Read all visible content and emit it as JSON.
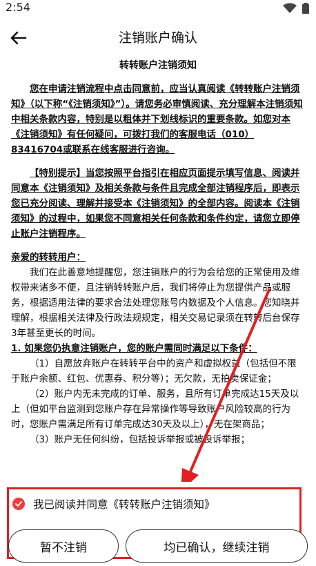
{
  "status_bar": {
    "time": "2:54"
  },
  "header": {
    "title": "注销账户确认"
  },
  "document": {
    "title": "转转账户注销须知",
    "intro": "您在申请注销流程中点击同意前，应当认真阅读《转转账户注销须知》（以下称“《注销须知》”）。请您务必审慎阅读、充分理解本注销须知中相关条款内容，特别是以粗体并下划线标识的重要条款。如您对本《注销须知》有任何疑问，可拨打我们的客服电话（010）83416704或联系在线客服进行咨询。",
    "notice": "【特别提示】当您按照平台指引在相应页面提示填写信息、阅读并同意本《注销须知》及相关条款与条件且完成全部注销程序后，即表示您已充分阅读、理解并接受本《注销须知》的全部内容。阅读本《注销须知》的过程中，如果您不同意相关任何条款和条件约定，请您立即停止账户注销程序。",
    "greeting": "亲爱的转转用户：",
    "body": "我们在此善意地提醒您，您注销账户的行为会给您的正常使用及维权带来诸多不便，且注销转转账户后，我们将停止为您提供产品或服务，根据适用法律的要求合法处理您账号内数据及个人信息。您知晓并理解，根据相关法律及行政法规规定，相关交易记录须在转转后台保存3年甚至更长的时间。",
    "section1": "1. 如果您仍执意注销账户，您的账户需同时满足以下条件：",
    "item1": "（1）自愿放弃账户在转转平台中的资产和虚拟权益（包括但不限于账户余额、红包、优惠券、积分等）；无欠款，无拍卖保证金；",
    "item2": "（2）账户内无未完成的订单、服务，且所有订单完成达15天及以上（但如平台监测到您账户存在异常操作等导致账户风险较高的行为时，您账户需满足所有订单完成达30天及以上），无在架商品；",
    "item3": "（3）账户无任何纠纷，包括投诉举报或被投诉举报；"
  },
  "footer": {
    "agree_text": "我已阅读并同意《转转账户注销须知》",
    "cancel_label": "暂不注销",
    "confirm_label": "均已确认，继续注销"
  },
  "colors": {
    "accent": "#f23a3a",
    "annotation": "#e02020"
  }
}
